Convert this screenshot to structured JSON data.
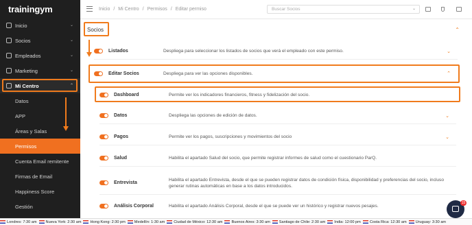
{
  "brand": {
    "logo": "trainingym"
  },
  "sidebar": {
    "items": [
      {
        "label": "Inicio",
        "icon": "home-icon"
      },
      {
        "label": "Socios",
        "icon": "users-icon"
      },
      {
        "label": "Empleados",
        "icon": "employees-icon"
      },
      {
        "label": "Marketing",
        "icon": "marketing-icon"
      },
      {
        "label": "Mi Centro",
        "icon": "center-icon"
      }
    ],
    "subitems": [
      {
        "label": "Datos"
      },
      {
        "label": "APP"
      },
      {
        "label": "Áreas y Salas"
      },
      {
        "label": "Permisos"
      },
      {
        "label": "Cuenta Email remitente"
      },
      {
        "label": "Firmas de Email"
      },
      {
        "label": "Happiness Score"
      },
      {
        "label": "Gestión"
      }
    ]
  },
  "topbar": {
    "breadcrumb": [
      "Inicio",
      "Mi Centro",
      "Permisos",
      "Editar permiso"
    ],
    "search_placeholder": "Buscar Socios"
  },
  "section": {
    "title": "Socios"
  },
  "rows": [
    {
      "name": "Listados",
      "desc": "Despliega para seleccionar los listados de socios que verá el empleado con este permiso.",
      "chev": "⌄"
    },
    {
      "name": "Editar Socios",
      "desc": "Despliega para ver las opciones disponibles.",
      "chev": "⌃"
    },
    {
      "name": "Dashboard",
      "desc": "Permite ver los indicadores financieros, fitness y fidelización del socio."
    },
    {
      "name": "Datos",
      "desc": "Despliega las opciones de edición de datos.",
      "chev": "⌄"
    },
    {
      "name": "Pagos",
      "desc": "Permite ver los pagos, suscripciones y movimientos del socio",
      "chev": "⌄"
    },
    {
      "name": "Salud",
      "desc": "Habilita el apartado Salud del socio, que permite registrar informes de salud como el cuestionario ParQ."
    },
    {
      "name": "Entrevista",
      "desc": "Habilita el apartado Entrevista, desde el que se pueden registrar datos de condición física, disponibilidad y preferencias del socio, incluso generar rutinas automáticas en base a los datos introducidos."
    },
    {
      "name": "Análisis Corporal",
      "desc": "Habilita el apartado Análisis Corporal, desde el que se puede ver un histórico y registrar nuevos pesajes."
    }
  ],
  "chat": {
    "badge": "15"
  },
  "ticker": [
    "Londres: 7:30 am",
    "Nueva York: 2:30 am",
    "Hong Kong: 2:30 pm",
    "Medellín: 1:30 am",
    "Ciudad de México: 12:30 am",
    "Buenos Aires: 3:30 am",
    "Santiago de Chile: 2:30 am",
    "India: 12:00 pm",
    "Costa Rica: 12:30 am",
    "Uruguay: 3:30 am"
  ],
  "colors": {
    "accent": "#f07b1c",
    "sidebar": "#1f1f1f"
  }
}
